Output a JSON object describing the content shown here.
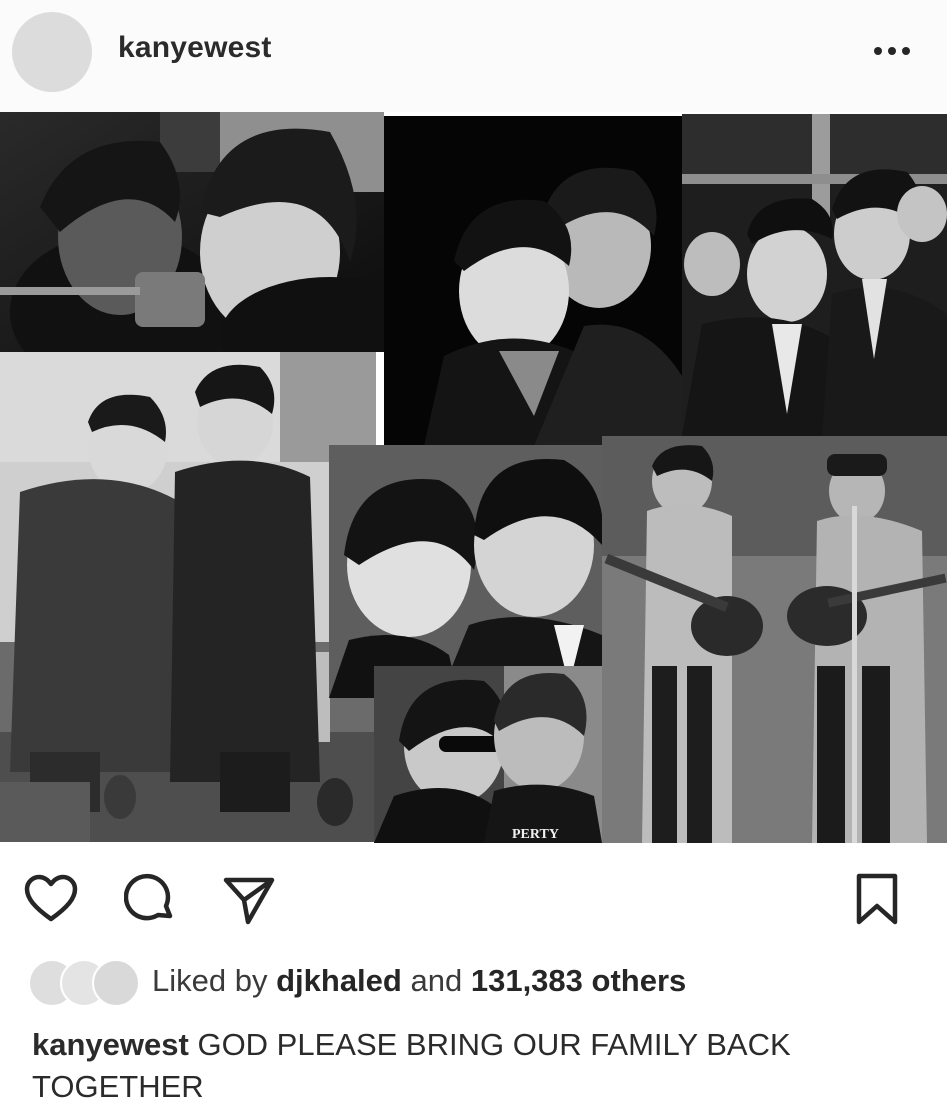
{
  "post": {
    "username": "kanyewest",
    "more_icon": "more-horizontal-icon",
    "media_description_icons": [
      "heart-icon",
      "comment-icon",
      "share-icon",
      "bookmark-icon"
    ],
    "likes": {
      "prefix": "Liked by",
      "user": "djkhaled",
      "connector": "and",
      "count": "131,383",
      "suffix": "others"
    },
    "caption": {
      "username": "kanyewest",
      "text": "GOD PLEASE BRING OUR FAMILY BACK TOGETHER"
    },
    "collage_overlay_text": "PERTY"
  },
  "colors": {
    "text": "#262626",
    "muted": "#3a3a3a",
    "avatar_placeholder": "#dcdcdc",
    "background": "#ffffff"
  }
}
